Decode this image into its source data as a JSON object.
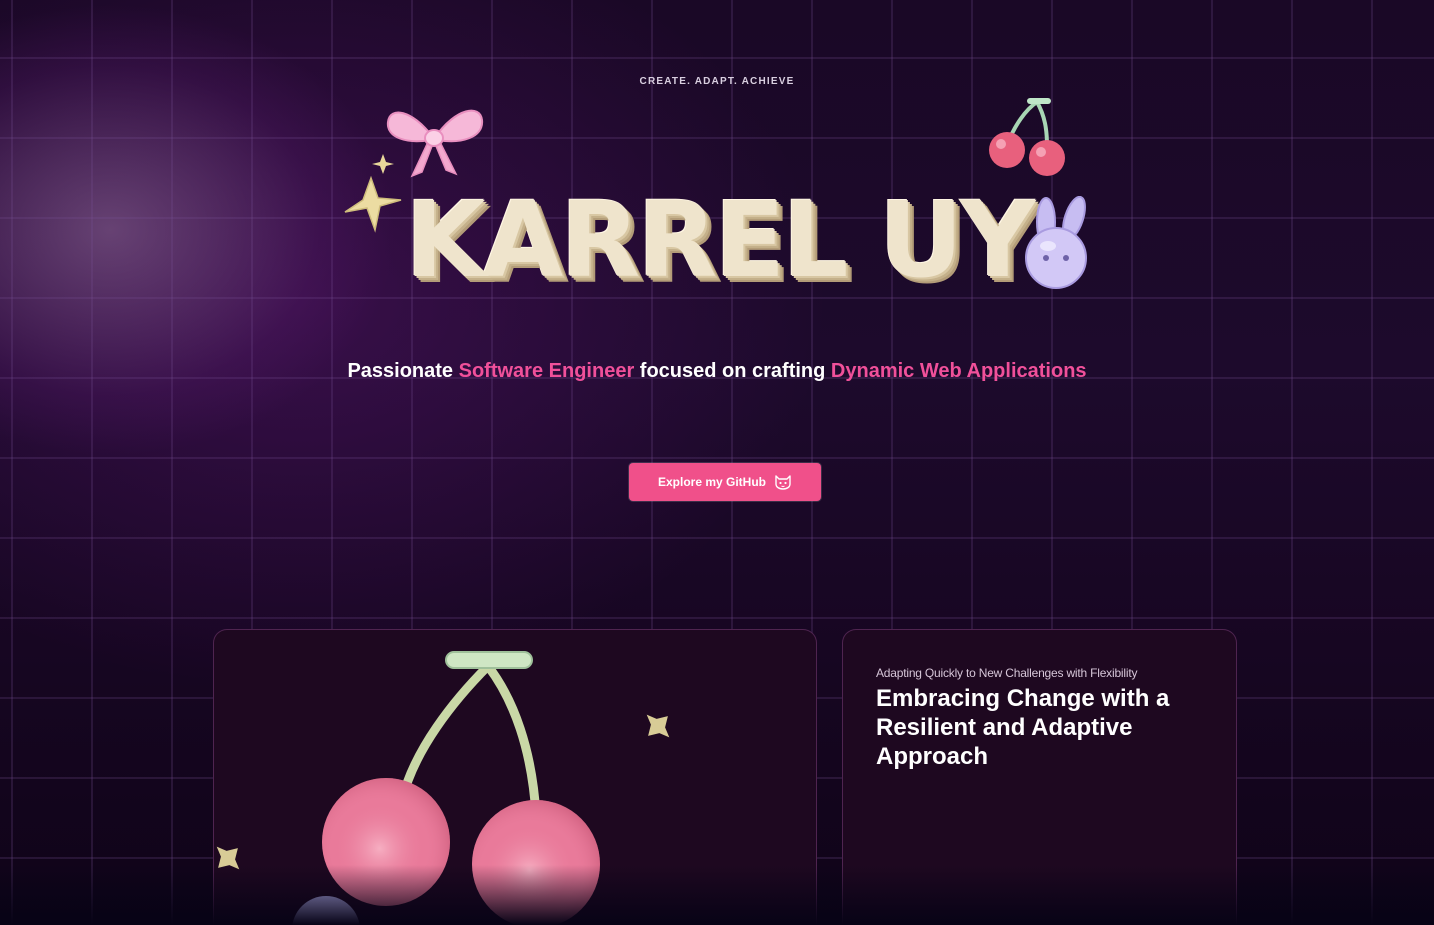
{
  "hero": {
    "eyebrow": "CREATE. ADAPT. ACHIEVE",
    "title": "KARREL UY"
  },
  "tagline": {
    "part1": "Passionate ",
    "highlight1": "Software Engineer",
    "part2": " focused on crafting ",
    "highlight2": "Dynamic Web Applications"
  },
  "cta": {
    "label": "Explore my GitHub",
    "icon": "github-cat-icon"
  },
  "cards": {
    "adaptive": {
      "eyebrow": "Adapting Quickly to New Challenges with Flexibility",
      "heading": "Embracing Change with a Resilient and Adaptive Approach"
    }
  },
  "decorations": [
    "bow-icon",
    "sparkle-star-icon",
    "cherry-icon",
    "bunny-icon"
  ],
  "colors": {
    "accent": "#f0509a",
    "button": "#f0508a",
    "title": "#efe4cc",
    "background": "#15061f"
  }
}
